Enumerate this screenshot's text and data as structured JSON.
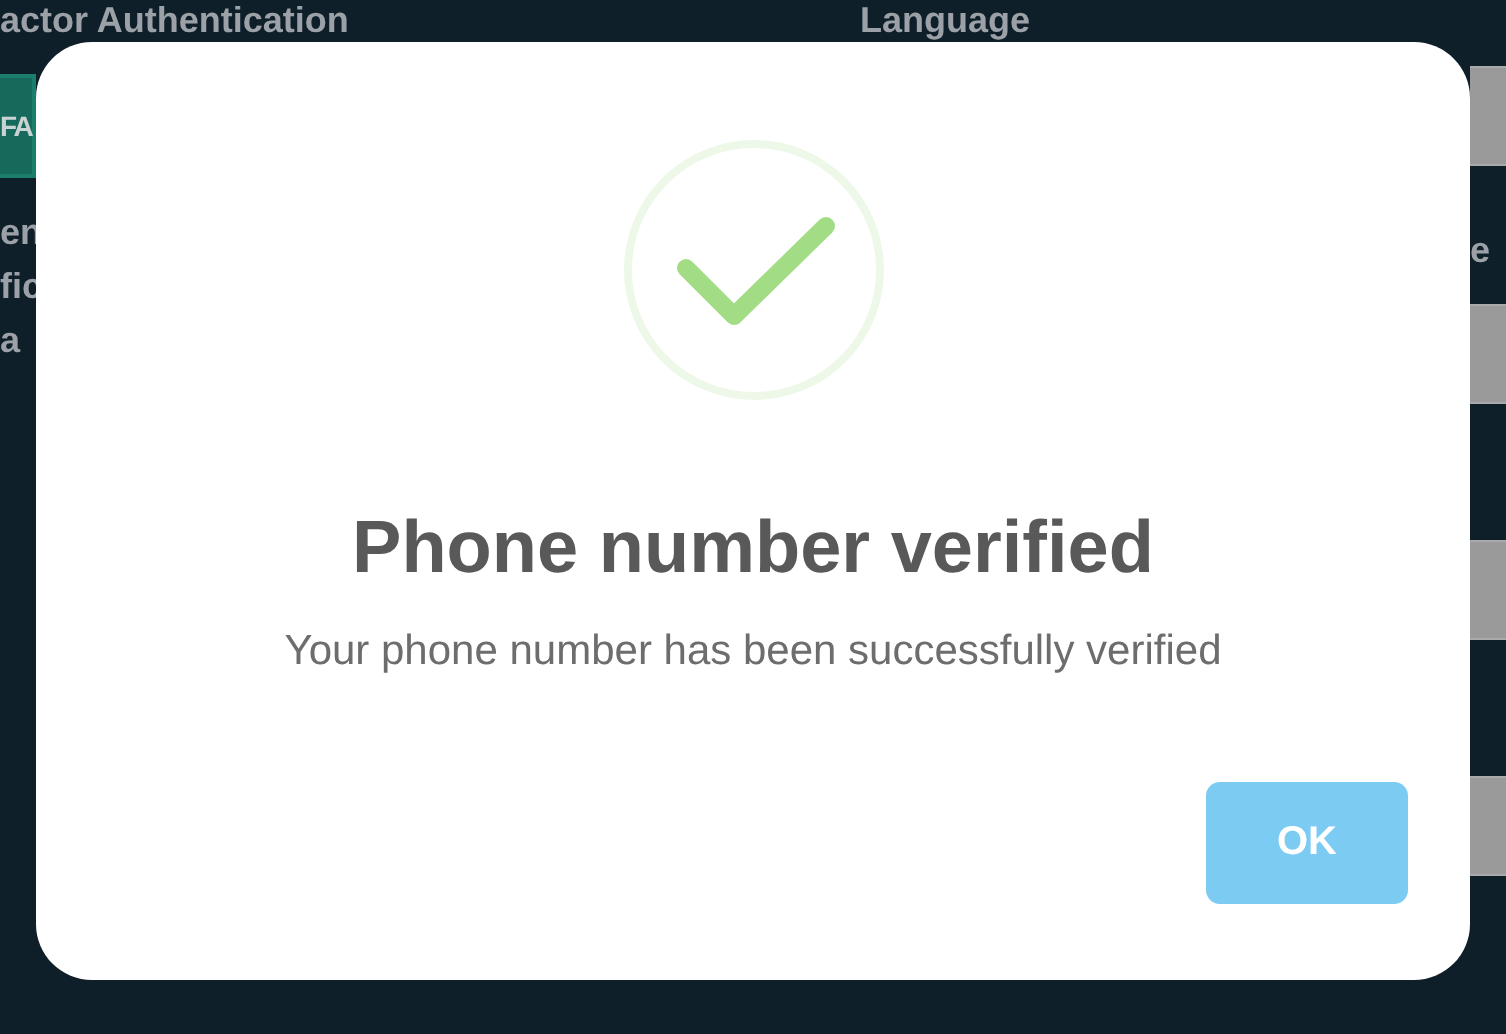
{
  "background": {
    "left_heading": "actor Authentication",
    "twofa_button": "FA",
    "left_text_lines": [
      "en",
      "fic",
      "a"
    ],
    "right_heading": "Language",
    "right_text": "e"
  },
  "dialog": {
    "title": "Phone number verified",
    "message": "Your phone number has been successfully verified",
    "buttons": [
      {
        "label": "OK"
      }
    ]
  }
}
